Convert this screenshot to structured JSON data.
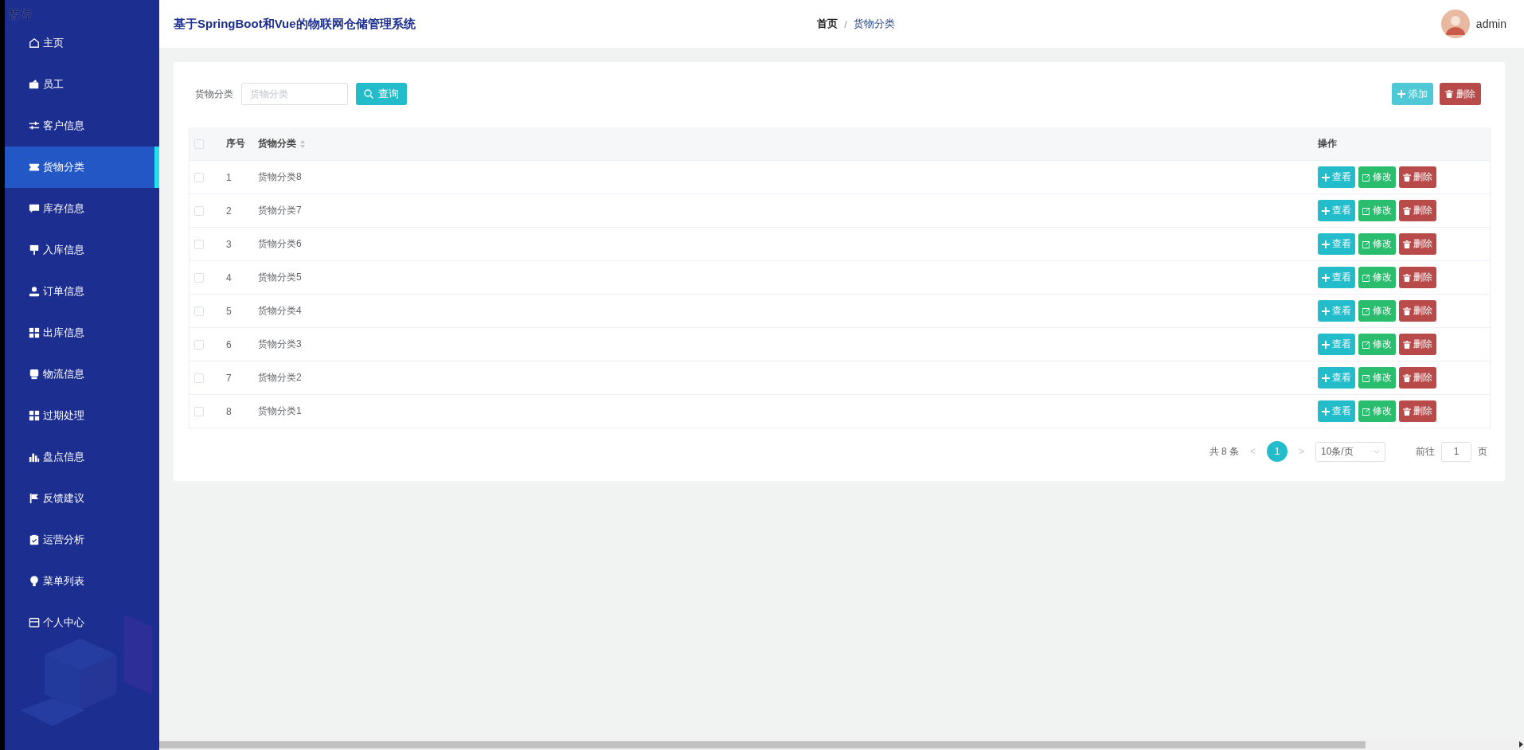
{
  "overlay_label": "暂停",
  "sidebar": {
    "items": [
      {
        "label": "主页",
        "selected": false
      },
      {
        "label": "员工",
        "selected": false
      },
      {
        "label": "客户信息",
        "selected": false
      },
      {
        "label": "货物分类",
        "selected": true
      },
      {
        "label": "库存信息",
        "selected": false
      },
      {
        "label": "入库信息",
        "selected": false
      },
      {
        "label": "订单信息",
        "selected": false
      },
      {
        "label": "出库信息",
        "selected": false
      },
      {
        "label": "物流信息",
        "selected": false
      },
      {
        "label": "过期处理",
        "selected": false
      },
      {
        "label": "盘点信息",
        "selected": false
      },
      {
        "label": "反馈建议",
        "selected": false
      },
      {
        "label": "运营分析",
        "selected": false
      },
      {
        "label": "菜单列表",
        "selected": false
      },
      {
        "label": "个人中心",
        "selected": false
      }
    ]
  },
  "header": {
    "title": "基于SpringBoot和Vue的物联网仓储管理系统",
    "breadcrumb": [
      {
        "label": "首页",
        "current": false
      },
      {
        "label": "货物分类",
        "current": true
      }
    ],
    "separator": "/",
    "user": "admin"
  },
  "search": {
    "label": "货物分类",
    "placeholder": "货物分类",
    "button": "查询"
  },
  "toolbar": [
    {
      "label": "添加",
      "kind": "add",
      "hovered": true
    },
    {
      "label": "删除",
      "kind": "delete",
      "hovered": false
    }
  ],
  "table": {
    "all_checked": false,
    "columns": [
      {
        "label": "序号"
      },
      {
        "label": "货物分类",
        "sortable": true
      },
      {
        "label": "操作"
      }
    ],
    "rows": [
      {
        "index": "1",
        "name": "货物分类8",
        "checked": false,
        "actions": [
          {
            "label": "查看",
            "kind": "view"
          },
          {
            "label": "修改",
            "kind": "edit"
          },
          {
            "label": "删除",
            "kind": "delete"
          }
        ]
      },
      {
        "index": "2",
        "name": "货物分类7",
        "checked": false,
        "actions": [
          {
            "label": "查看",
            "kind": "view"
          },
          {
            "label": "修改",
            "kind": "edit"
          },
          {
            "label": "删除",
            "kind": "delete"
          }
        ]
      },
      {
        "index": "3",
        "name": "货物分类6",
        "checked": false,
        "actions": [
          {
            "label": "查看",
            "kind": "view"
          },
          {
            "label": "修改",
            "kind": "edit"
          },
          {
            "label": "删除",
            "kind": "delete"
          }
        ]
      },
      {
        "index": "4",
        "name": "货物分类5",
        "checked": false,
        "actions": [
          {
            "label": "查看",
            "kind": "view"
          },
          {
            "label": "修改",
            "kind": "edit"
          },
          {
            "label": "删除",
            "kind": "delete"
          }
        ]
      },
      {
        "index": "5",
        "name": "货物分类4",
        "checked": false,
        "actions": [
          {
            "label": "查看",
            "kind": "view"
          },
          {
            "label": "修改",
            "kind": "edit"
          },
          {
            "label": "删除",
            "kind": "delete"
          }
        ]
      },
      {
        "index": "6",
        "name": "货物分类3",
        "checked": false,
        "actions": [
          {
            "label": "查看",
            "kind": "view"
          },
          {
            "label": "修改",
            "kind": "edit"
          },
          {
            "label": "删除",
            "kind": "delete"
          }
        ]
      },
      {
        "index": "7",
        "name": "货物分类2",
        "checked": false,
        "actions": [
          {
            "label": "查看",
            "kind": "view"
          },
          {
            "label": "修改",
            "kind": "edit"
          },
          {
            "label": "删除",
            "kind": "delete"
          }
        ]
      },
      {
        "index": "8",
        "name": "货物分类1",
        "checked": false,
        "actions": [
          {
            "label": "查看",
            "kind": "view"
          },
          {
            "label": "修改",
            "kind": "edit"
          },
          {
            "label": "删除",
            "kind": "delete"
          }
        ]
      }
    ]
  },
  "pagination": {
    "total": "共 8 条",
    "prev": "<",
    "pages": [
      {
        "label": "1",
        "selected": true
      }
    ],
    "next": ">",
    "page_size": "10条/页",
    "goto_label": "前往",
    "goto_value": "1",
    "goto_suffix": "页"
  }
}
